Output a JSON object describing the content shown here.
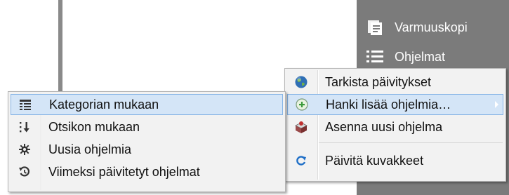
{
  "background": {
    "right_panel": [
      {
        "label": "Varmuuskopi",
        "icon": "backup-icon"
      },
      {
        "label": "Ohjelmat",
        "icon": "list-icon"
      }
    ]
  },
  "main_menu": {
    "items": [
      {
        "label": "Tarkista päivitykset",
        "icon": "globe-icon"
      },
      {
        "label": "Hanki lisää ohjelmia…",
        "icon": "add-circle-icon",
        "highlighted": true,
        "has_submenu": true
      },
      {
        "label": "Asenna uusi ohjelma",
        "icon": "install-box-icon"
      },
      {
        "label": "Päivitä kuvakkeet",
        "icon": "refresh-icon"
      }
    ]
  },
  "submenu": {
    "items": [
      {
        "label": "Kategorian mukaan",
        "icon": "category-list-icon",
        "highlighted": true
      },
      {
        "label": "Otsikon mukaan",
        "icon": "sort-down-icon"
      },
      {
        "label": "Uusia ohjelmia",
        "icon": "sun-icon"
      },
      {
        "label": "Viimeksi päivitetyt ohjelmat",
        "icon": "history-icon"
      }
    ]
  },
  "colors": {
    "highlight_bg": "#d4e5f7",
    "highlight_border": "#86b4e6",
    "menu_bg": "#f2f2f2",
    "panel_bg": "#7b7b7b"
  }
}
